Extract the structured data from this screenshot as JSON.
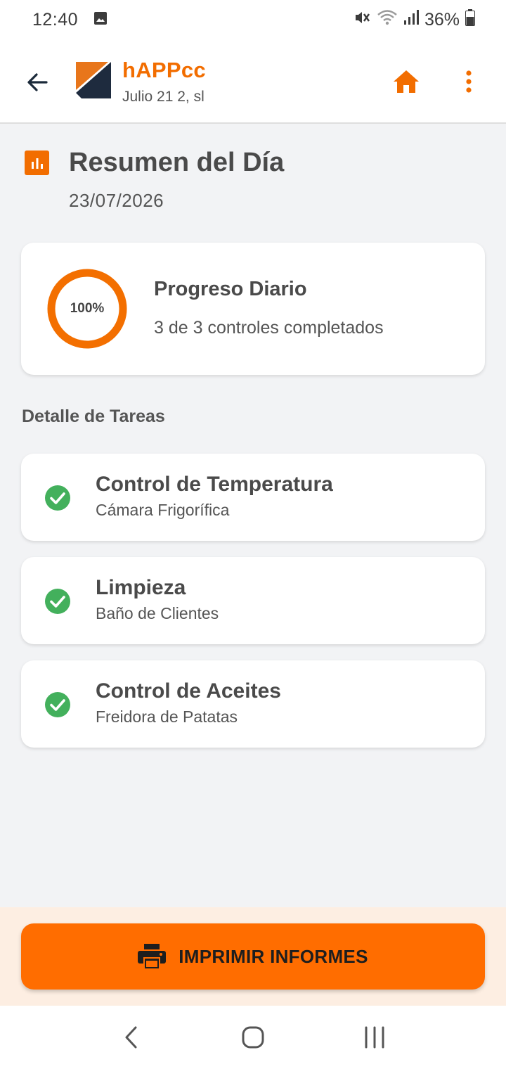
{
  "status_bar": {
    "time": "12:40",
    "battery": "36%",
    "icons": [
      "image-icon",
      "mute-icon",
      "wifi-icon",
      "signal-icon",
      "battery-icon"
    ]
  },
  "app_bar": {
    "brand_name": "hAPPcc",
    "business_name": "Julio 21 2, sl",
    "icons": [
      "back-arrow-icon",
      "home-icon",
      "more-vert-icon"
    ],
    "accent_color": "#f26d00"
  },
  "summary": {
    "title": "Resumen del Día",
    "date": "23/07/2026",
    "icon": "bar-chart-icon"
  },
  "progress": {
    "percent_label": "100%",
    "percent_value": 100,
    "title": "Progreso Diario",
    "subtitle": "3 de 3 controles completados"
  },
  "tasks_section": {
    "label": "Detalle de Tareas",
    "items": [
      {
        "title": "Control de Temperatura",
        "location": "Cámara Frigorífica",
        "status": "completed"
      },
      {
        "title": "Limpieza",
        "location": "Baño de Clientes",
        "status": "completed"
      },
      {
        "title": "Control de Aceites",
        "location": "Freidora de Patatas",
        "status": "completed"
      }
    ],
    "check_color": "#43b05c"
  },
  "print_button": {
    "label": "IMPRIMIR INFORMES",
    "icon": "printer-icon",
    "color": "#ff6d00"
  },
  "nav_bar": {
    "icons": [
      "nav-back-icon",
      "nav-home-icon",
      "nav-recents-icon"
    ]
  }
}
